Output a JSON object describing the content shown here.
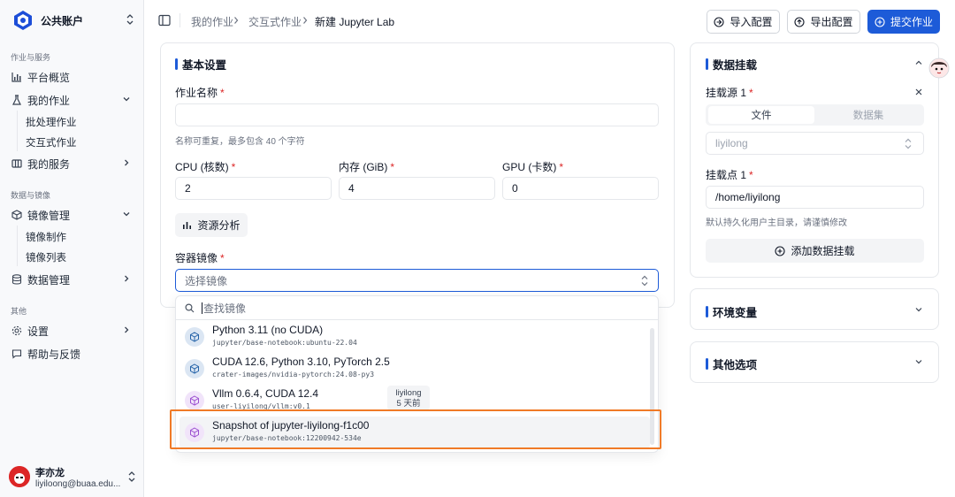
{
  "account": {
    "name": "公共账户"
  },
  "sidebar": {
    "sections": [
      {
        "title": "作业与服务"
      },
      {
        "title": "数据与镜像"
      },
      {
        "title": "其他"
      }
    ],
    "items": {
      "overview": "平台概览",
      "my_jobs": "我的作业",
      "batch_jobs": "批处理作业",
      "interactive_jobs": "交互式作业",
      "my_services": "我的服务",
      "image_mgmt": "镜像管理",
      "image_build": "镜像制作",
      "image_list": "镜像列表",
      "data_mgmt": "数据管理",
      "settings": "设置",
      "help": "帮助与反馈"
    },
    "user": {
      "name": "李亦龙",
      "email": "liyiloong@buaa.edu..."
    }
  },
  "breadcrumb": {
    "items": [
      "我的作业",
      "交互式作业"
    ],
    "current": "新建 Jupyter Lab"
  },
  "actions": {
    "import": "导入配置",
    "export": "导出配置",
    "submit": "提交作业"
  },
  "basic": {
    "title": "基本设置",
    "job_name_label": "作业名称",
    "job_name_value": "",
    "job_name_hint": "名称可重复，最多包含 40 个字符",
    "cpu_label": "CPU (核数)",
    "cpu_value": "2",
    "mem_label": "内存 (GiB)",
    "mem_value": "4",
    "gpu_label": "GPU (卡数)",
    "gpu_value": "0",
    "analyze_button": "资源分析",
    "image_label": "容器镜像",
    "image_placeholder": "选择镜像",
    "image_search_placeholder": "查找镜像"
  },
  "image_options": [
    {
      "name": "Python 3.11 (no CUDA)",
      "path": "jupyter/base-notebook:ubuntu-22.04",
      "icon": "cube-icon",
      "color": "#dbe6f3"
    },
    {
      "name": "CUDA 12.6, Python 3.10, PyTorch 2.5",
      "path": "crater-images/nvidia-pytorch:24.08-py3",
      "icon": "cube-icon",
      "color": "#dbe6f3"
    },
    {
      "name": "Vllm 0.6.4, CUDA 12.4",
      "path": "user-liyilong/vllm:v0.1",
      "icon": "cube-icon",
      "color": "#f1e4fa"
    },
    {
      "name": "Snapshot of jupyter-liyilong-f1c00",
      "path": "jupyter/base-notebook:12200942-534e",
      "icon": "cube-icon",
      "color": "#f1e4fa"
    }
  ],
  "tooltip": {
    "user": "liyilong",
    "time": "5 天前"
  },
  "mount": {
    "title": "数据挂载",
    "source_label": "挂载源 1",
    "tab_file": "文件",
    "tab_dataset": "数据集",
    "source_value": "liyilong",
    "mountpoint_label": "挂载点 1",
    "mountpoint_value": "/home/liyilong",
    "mountpoint_hint": "默认持久化用户主目录，请谨慎修改",
    "add_button": "添加数据挂载"
  },
  "env": {
    "title": "环境变量"
  },
  "other": {
    "title": "其他选项"
  },
  "colors": {
    "primary": "#1d5bd8",
    "highlight": "#f07a27",
    "required": "#dc2626"
  }
}
